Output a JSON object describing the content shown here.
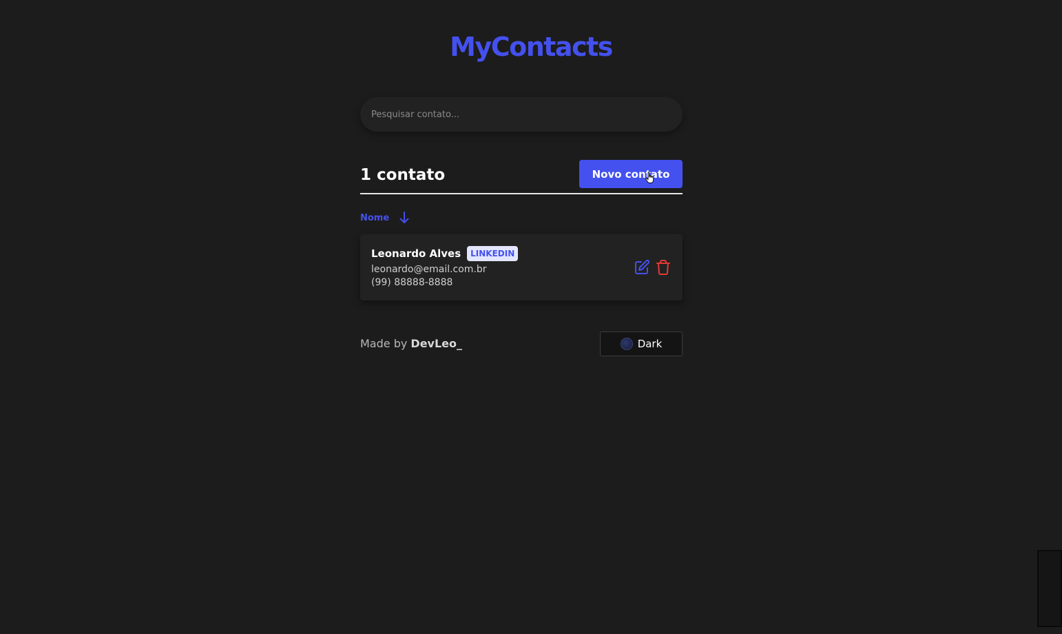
{
  "app": {
    "logo": "MyContacts"
  },
  "search": {
    "placeholder": "Pesquisar contato..."
  },
  "list_header": {
    "count_label": "1 contato",
    "new_button": "Novo contato"
  },
  "sort": {
    "label": "Nome",
    "icon": "arrow-down-icon"
  },
  "contacts": [
    {
      "name": "Leonardo Alves",
      "category": "LINKEDIN",
      "email": "leonardo@email.com.br",
      "phone": "(99) 88888-8888"
    }
  ],
  "footer": {
    "made_by_prefix": "Made by",
    "author": "DevLeo_",
    "theme_label": "Dark"
  },
  "colors": {
    "primary": "#4451ee",
    "background": "#1c1c1c",
    "card": "#222222",
    "danger": "#e53935",
    "tag_background": "#e3e6ff"
  }
}
